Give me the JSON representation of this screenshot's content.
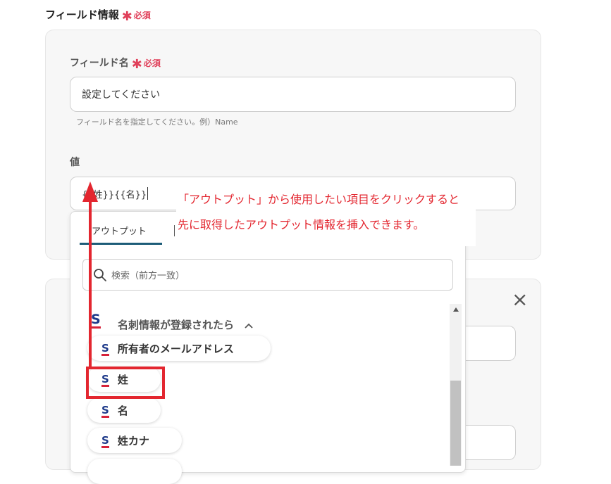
{
  "section": {
    "title": "フィールド情報",
    "required_mark": "✱",
    "required_label": "必須"
  },
  "field_name": {
    "label": "フィールド名",
    "required_mark": "✱",
    "required_label": "必須",
    "placeholder": "設定してください",
    "hint": "フィールド名を指定してください。例）Name"
  },
  "value_field": {
    "label": "値",
    "value": "{{姓}}{{名}}"
  },
  "dropdown": {
    "tabs": [
      {
        "label": "アウトプット",
        "active": true
      }
    ],
    "search_placeholder": "検索（前方一致）",
    "group": {
      "label": "名刺情報が登録されたら",
      "app_icon": "S"
    },
    "items": [
      {
        "label": "所有者のメールアドレス",
        "icon": "S"
      },
      {
        "label": "姓",
        "icon": "S",
        "highlighted": true
      },
      {
        "label": "名",
        "icon": "S"
      },
      {
        "label": "姓カナ",
        "icon": "S"
      }
    ]
  },
  "annotation": {
    "line1": "「アウトプット」から使用したい項目をクリックすると",
    "line2": "先に取得したアウトプット情報を挿入できます。"
  },
  "second_panel": {
    "close_icon": "×"
  },
  "colors": {
    "required": "#e0405a",
    "annotation_red": "#e3262f",
    "tab_accent": "#1d5c78",
    "logo_blue": "#1e3a8a",
    "logo_red": "#d6223a"
  }
}
